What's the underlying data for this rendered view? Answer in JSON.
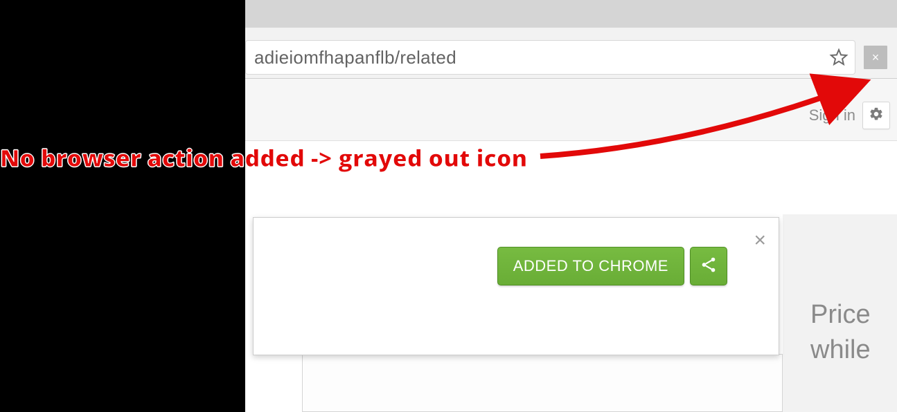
{
  "address_bar": {
    "url_fragment": "adieiomfhapanflb/related"
  },
  "annotation": {
    "text": "No browser action added -> grayed out icon"
  },
  "toolbar": {
    "signin_label": "Sign in"
  },
  "popup": {
    "added_label": "ADDED TO CHROME"
  },
  "side": {
    "line1": "Price",
    "line2": "while"
  }
}
